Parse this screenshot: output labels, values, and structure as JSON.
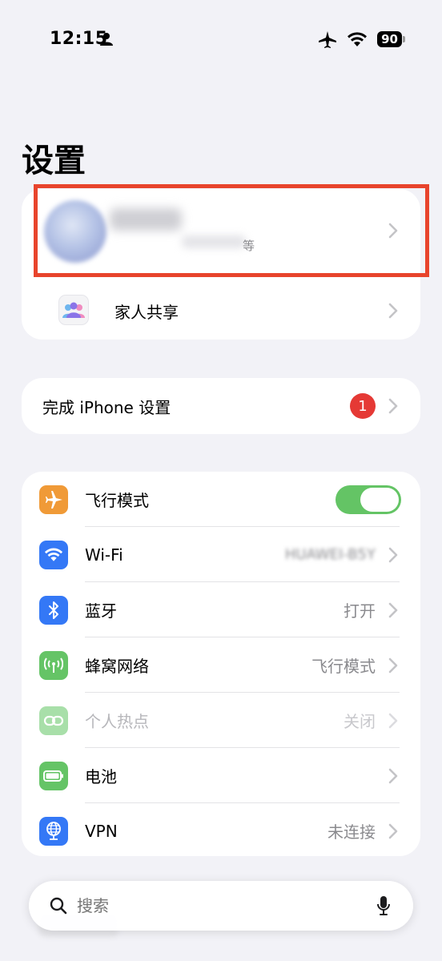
{
  "status_bar": {
    "time": "12:15",
    "battery_level": "90",
    "icons": [
      "person-icon",
      "airplane-icon",
      "wifi-icon",
      "battery-icon"
    ]
  },
  "page_title": "设置",
  "account_card": {
    "profile_subtitle_suffix": "等",
    "family_sharing_label": "家人共享"
  },
  "setup_card": {
    "label": "完成 iPhone 设置",
    "badge_count": "1"
  },
  "connectivity": {
    "items": [
      {
        "label": "飞行模式",
        "value": "",
        "icon": "airplane-icon",
        "color": "#f09a37",
        "toggle_on": true
      },
      {
        "label": "Wi-Fi",
        "value": "HUAWEI-B5Y",
        "icon": "wifi-icon",
        "color": "#3478f6"
      },
      {
        "label": "蓝牙",
        "value": "打开",
        "icon": "bluetooth-icon",
        "color": "#3478f6"
      },
      {
        "label": "蜂窝网络",
        "value": "飞行模式",
        "icon": "cellular-icon",
        "color": "#65c466"
      },
      {
        "label": "个人热点",
        "value": "关闭",
        "icon": "hotspot-icon",
        "color": "#a8dfa9",
        "disabled": true
      },
      {
        "label": "电池",
        "value": "",
        "icon": "battery-icon",
        "color": "#65c466"
      },
      {
        "label": "VPN",
        "value": "未连接",
        "icon": "vpn-globe-icon",
        "color": "#3478f6"
      }
    ]
  },
  "search": {
    "placeholder": "搜索"
  }
}
